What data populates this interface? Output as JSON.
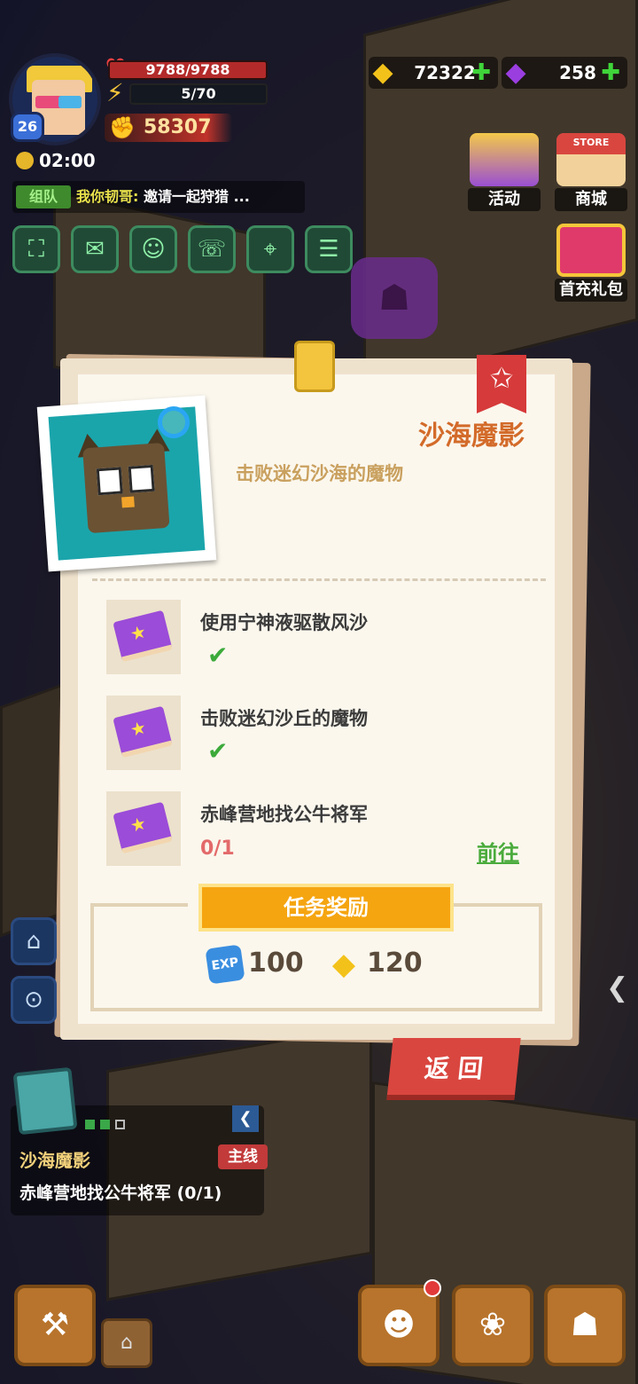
{
  "player": {
    "level": "26",
    "hp": "9788/9788",
    "energy": "5/70",
    "power": "58307",
    "timer": "02:00"
  },
  "currency": {
    "gold": "72322",
    "gems": "258",
    "plus_symbol": "✚"
  },
  "chat": {
    "channel": "组队",
    "sender": "我你韧哥:",
    "message": "邀请一起狩猎 ..."
  },
  "side_buttons": {
    "event": "活动",
    "shop": "商城",
    "first_recharge": "首充礼包",
    "shop_sign": "STORE"
  },
  "quest": {
    "title": "沙海魔影",
    "subtitle": "击败迷幻沙海的魔物",
    "steps": [
      {
        "text": "使用宁神液驱散风沙",
        "status": "done"
      },
      {
        "text": "击败迷幻沙丘的魔物",
        "status": "done"
      },
      {
        "text": "赤峰营地找公牛将军",
        "progress": "0/1",
        "action": "前往"
      }
    ],
    "reward_title": "任务奖励",
    "rewards": {
      "exp_icon": "EXP",
      "exp": "100",
      "coins": "120"
    },
    "back": "返 回"
  },
  "tracker": {
    "title": "沙海魔影",
    "type": "主线",
    "objective": "赤峰营地找公牛将军   (0/1)",
    "page": 1,
    "pages": 3
  },
  "colors": {
    "accent_orange": "#f5a510",
    "title_orange": "#d36b2a",
    "done_green": "#3caa3a",
    "progress_red": "#e36a6a",
    "back_red": "#d9463f"
  }
}
